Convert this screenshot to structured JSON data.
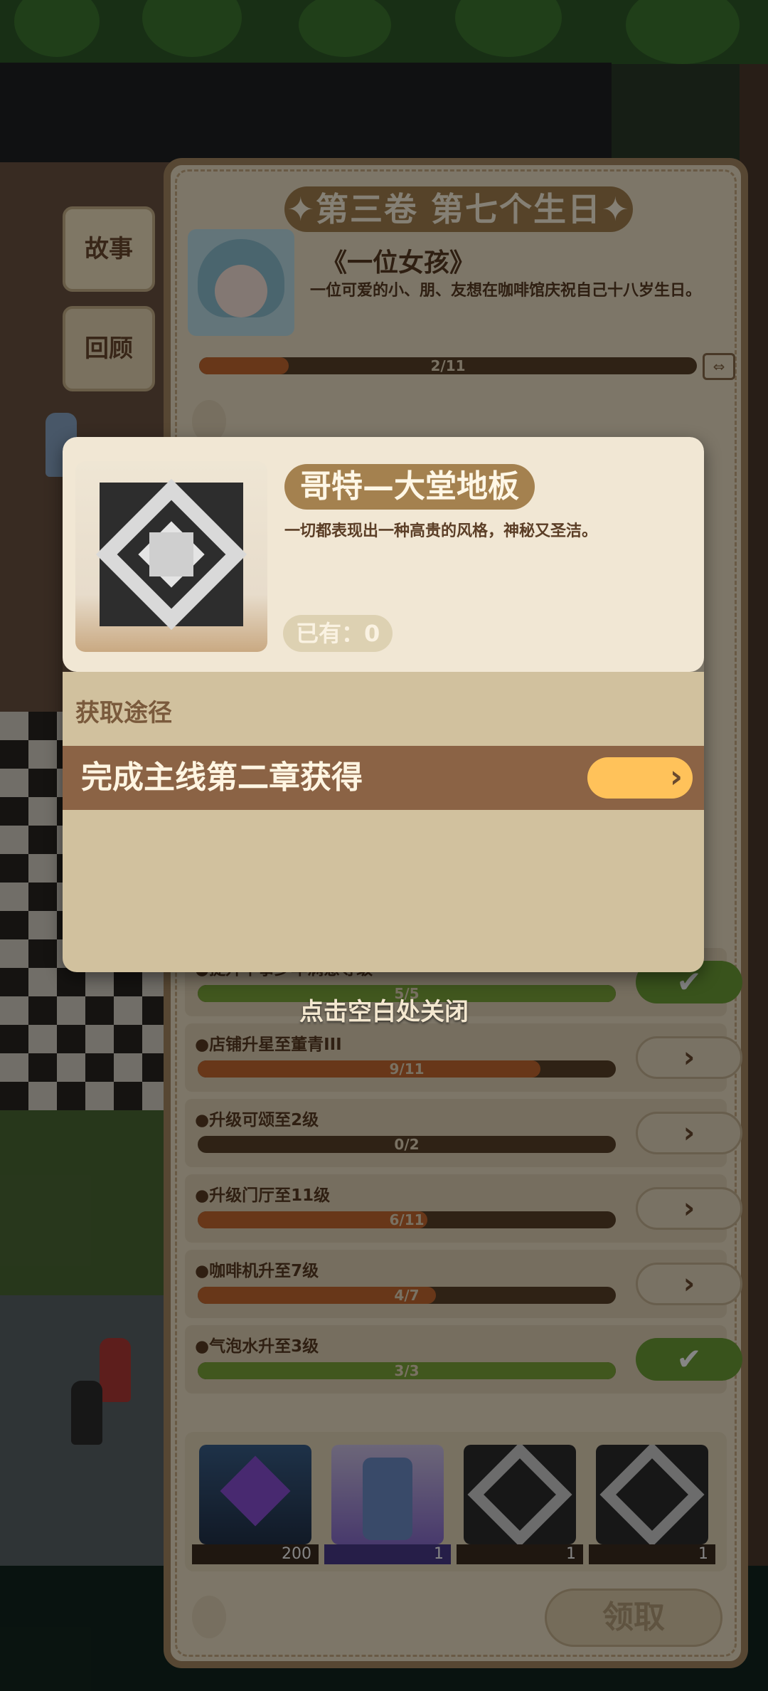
{
  "side_tabs": {
    "story": "故事",
    "review": "回顾"
  },
  "chapter": {
    "title": "✦第三卷 第七个生日✦",
    "story_title": "《一位女孩》",
    "story_desc": "一位可爱的小、朋、友想在咖啡馆庆祝自己十八岁生日。",
    "progress_text": "2/11",
    "progress_value": 0.18
  },
  "tasks": [
    {
      "label": "●提升牛事少年满意等级",
      "progress_text": "5/5",
      "progress_value": 1.0,
      "status": "done"
    },
    {
      "label": "●店铺升星至董青III",
      "progress_text": "9/11",
      "progress_value": 0.82,
      "status": "go"
    },
    {
      "label": "●升级可颂至2级",
      "progress_text": "0/2",
      "progress_value": 0.0,
      "status": "go"
    },
    {
      "label": "●升级门厅至11级",
      "progress_text": "6/11",
      "progress_value": 0.55,
      "status": "go"
    },
    {
      "label": "●咖啡机升至7级",
      "progress_text": "4/7",
      "progress_value": 0.57,
      "status": "go"
    },
    {
      "label": "●气泡水升至3级",
      "progress_text": "3/3",
      "progress_value": 1.0,
      "status": "done"
    }
  ],
  "rewards": [
    {
      "icon": "gem-card-icon",
      "count": "200"
    },
    {
      "icon": "bottle-icon",
      "count": "1"
    },
    {
      "icon": "floor-tile-icon",
      "count": "1"
    },
    {
      "icon": "floor-tile-icon",
      "count": "1"
    }
  ],
  "claim_label": "领取",
  "close_hint": "点击空白处关闭",
  "item": {
    "name": "哥特—大堂地板",
    "description": "一切都表现出一种高贵的风格，神秘又圣洁。",
    "owned": "已有：0",
    "acquire_label": "获取途径",
    "acquire_method": "完成主线第二章获得",
    "go_icon": "›"
  },
  "colors": {
    "progress_orange": "#c86a31",
    "progress_green": "#7ea73a",
    "go_button": "#ffc25a",
    "name_banner": "#a4814f"
  }
}
